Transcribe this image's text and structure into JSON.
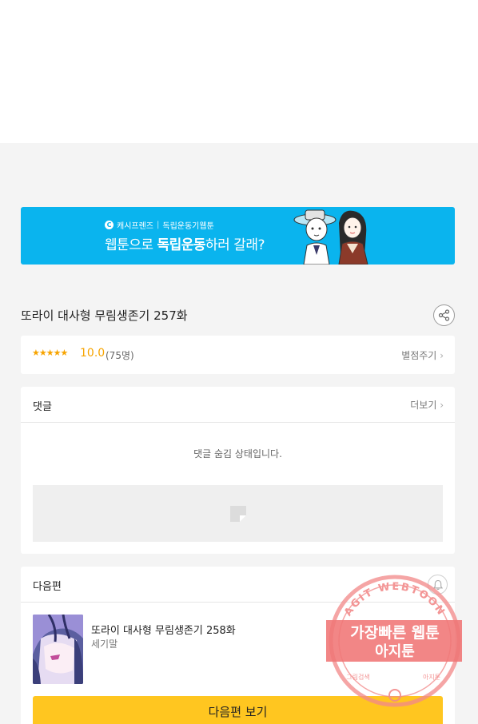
{
  "banner": {
    "brand": "캐시프렌즈",
    "series": "독립운동기웹툰",
    "headline_normal_1": "웹툰으로 ",
    "headline_bold": "독립운동",
    "headline_normal_2": "하러 갈래?"
  },
  "episode": {
    "title": "또라이 대사형 무림생존기 257화"
  },
  "rating": {
    "stars": "★★★★★",
    "score": "10.0",
    "count": "(75명)",
    "rate_link": "별점주기"
  },
  "comments": {
    "title": "댓글",
    "more_link": "더보기",
    "hidden_message": "댓글 숨김 상태입니다."
  },
  "next_episode": {
    "section_title": "다음편",
    "title": "또라이 대사형 무림생존기 258화",
    "author": "세기말",
    "button_label": "다음편 보기"
  },
  "watermark": {
    "top_text": "AGIT WEBTOON",
    "line1": "가장빠른 웹툰",
    "line2": "아지툰",
    "bottom_left": "그림검색",
    "bottom_right": "아지툰"
  },
  "colors": {
    "banner_bg": "#0ab4ee",
    "star": "#f7a400",
    "button": "#ffc620",
    "watermark": "#f06a6a"
  }
}
